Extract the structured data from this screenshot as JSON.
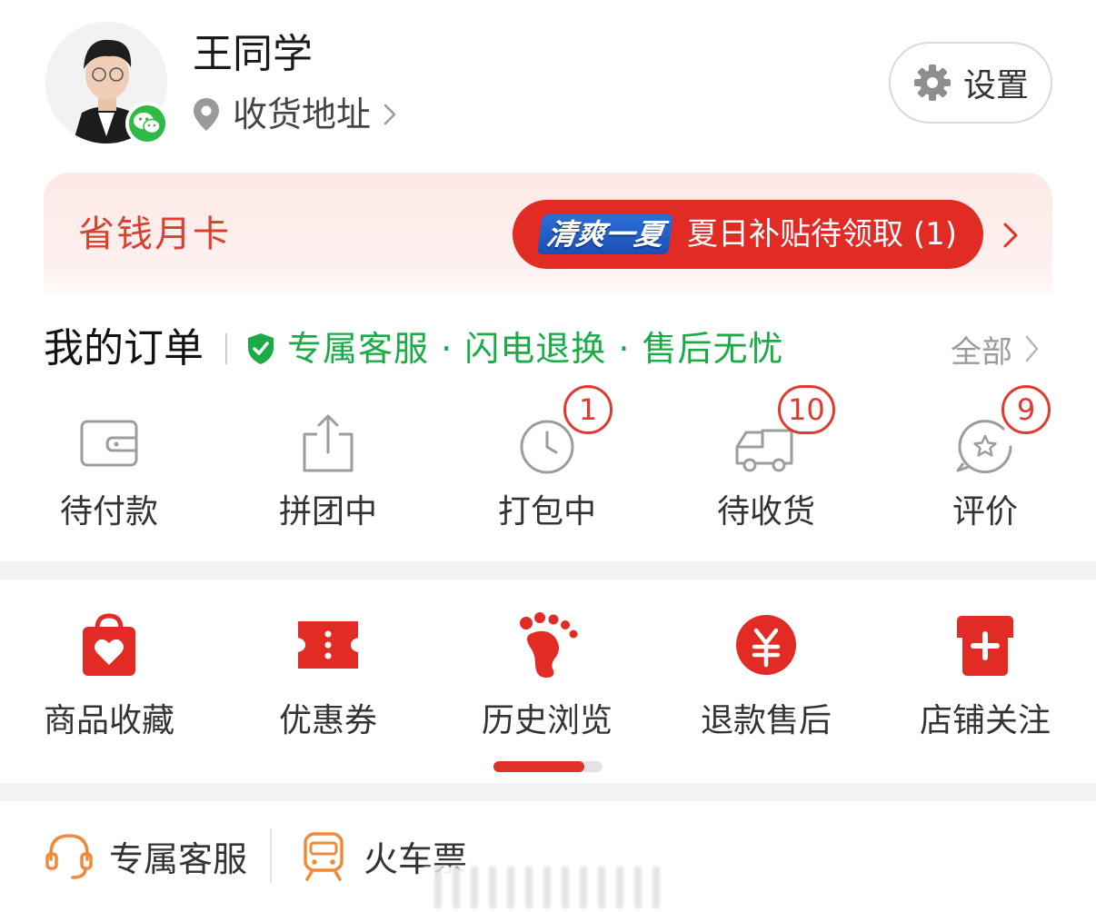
{
  "profile": {
    "username": "王同学",
    "address_label": "收货地址",
    "settings_label": "设置"
  },
  "savings": {
    "title": "省钱月卡",
    "promo_logo": "清爽一夏",
    "promo_text": "夏日补贴待领取 (1)"
  },
  "orders": {
    "title": "我的订单",
    "service_line": "专属客服 · 闪电退换 · 售后无忧",
    "all_label": "全部",
    "items": [
      {
        "label": "待付款",
        "badge": ""
      },
      {
        "label": "拼团中",
        "badge": ""
      },
      {
        "label": "打包中",
        "badge": "1"
      },
      {
        "label": "待收货",
        "badge": "10"
      },
      {
        "label": "评价",
        "badge": "9"
      }
    ]
  },
  "tools": {
    "items": [
      {
        "label": "商品收藏",
        "icon": "favorite-bag-icon"
      },
      {
        "label": "优惠券",
        "icon": "coupon-icon"
      },
      {
        "label": "历史浏览",
        "icon": "footprint-icon"
      },
      {
        "label": "退款售后",
        "icon": "yuan-refund-icon"
      },
      {
        "label": "店铺关注",
        "icon": "store-follow-icon"
      }
    ],
    "scroll_position": 0.83
  },
  "services": {
    "items": [
      {
        "label": "专属客服",
        "icon": "headset-icon"
      },
      {
        "label": "火车票",
        "icon": "train-icon"
      }
    ]
  },
  "colors": {
    "accent_red": "#e22b24",
    "green": "#1aab47",
    "orange_icon": "#f08a3a"
  }
}
